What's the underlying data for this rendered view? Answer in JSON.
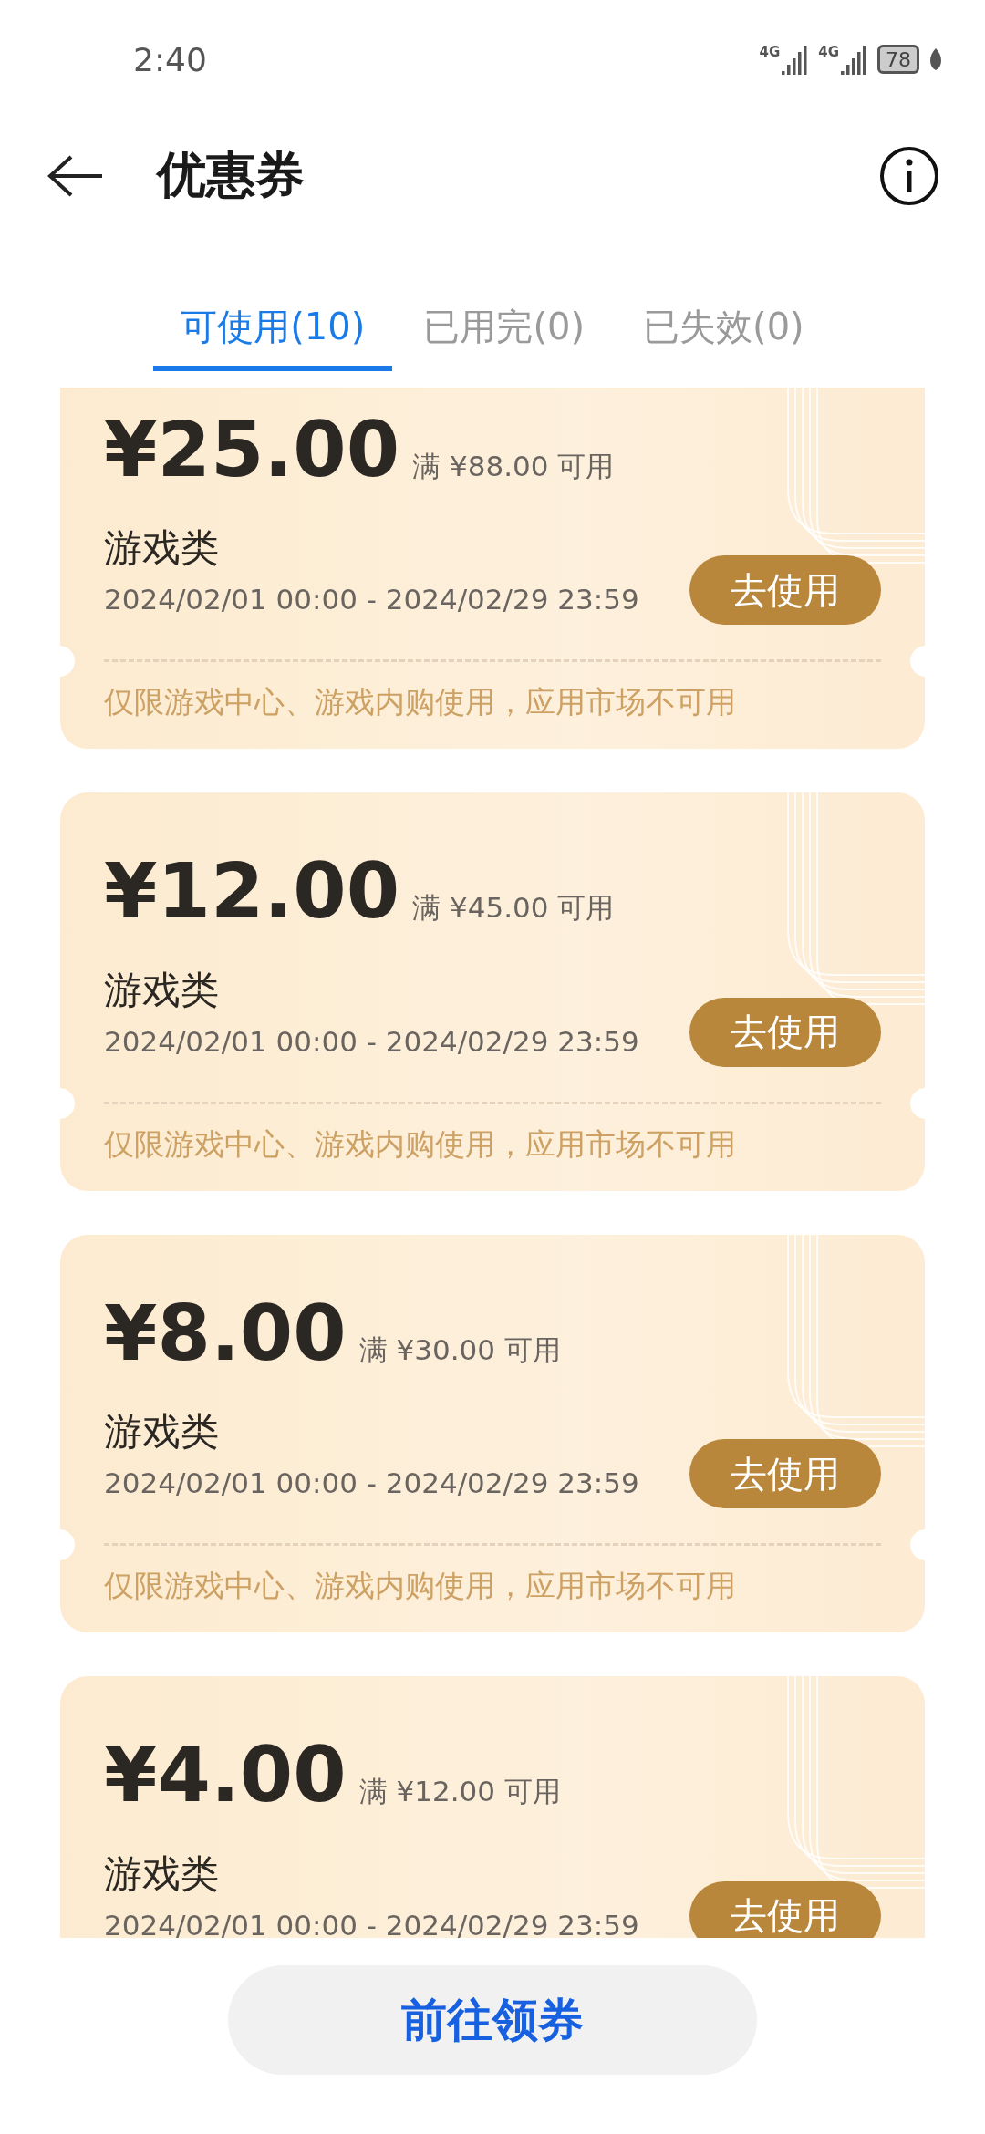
{
  "status_bar": {
    "time": "2:40",
    "networks": [
      "4G",
      "4G"
    ],
    "battery": "78"
  },
  "header": {
    "title": "优惠券"
  },
  "tabs": [
    {
      "label": "可使用(10)",
      "selected": true
    },
    {
      "label": "已用完(0)",
      "selected": false
    },
    {
      "label": "已失效(0)",
      "selected": false
    }
  ],
  "coupons": [
    {
      "amount": "¥25.00",
      "condition": "满 ¥88.00 可用",
      "category": "游戏类",
      "validity": "2024/02/01 00:00 - 2024/02/29 23:59",
      "button": "去使用",
      "note": "仅限游戏中心、游戏内购使用，应用市场不可用"
    },
    {
      "amount": "¥12.00",
      "condition": "满 ¥45.00 可用",
      "category": "游戏类",
      "validity": "2024/02/01 00:00 - 2024/02/29 23:59",
      "button": "去使用",
      "note": "仅限游戏中心、游戏内购使用，应用市场不可用"
    },
    {
      "amount": "¥8.00",
      "condition": "满 ¥30.00 可用",
      "category": "游戏类",
      "validity": "2024/02/01 00:00 - 2024/02/29 23:59",
      "button": "去使用",
      "note": "仅限游戏中心、游戏内购使用，应用市场不可用"
    },
    {
      "amount": "¥4.00",
      "condition": "满 ¥12.00 可用",
      "category": "游戏类",
      "validity": "2024/02/01 00:00 - 2024/02/29 23:59",
      "button": "去使用"
    }
  ],
  "bottom_button": {
    "label": "前往领券"
  }
}
